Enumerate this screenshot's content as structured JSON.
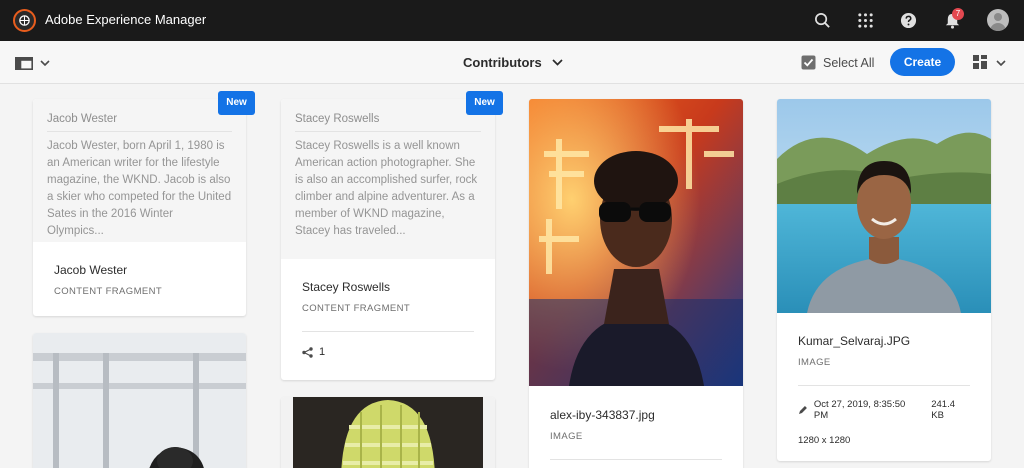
{
  "shell": {
    "title": "Adobe Experience Manager",
    "notification_count": "7",
    "icons": [
      "search-icon",
      "apps-grid-icon",
      "help-icon",
      "bell-icon",
      "user-avatar"
    ]
  },
  "actionbar": {
    "folder_title": "Contributors",
    "select_all_label": "Select All",
    "create_label": "Create"
  },
  "cards": [
    {
      "new_label": "New",
      "preview_title": "Jacob Wester",
      "preview_text": "Jacob Wester, born April 1, 1980 is an American writer for the lifestyle magazine, the WKND. Jacob is also a skier who competed for the United Sates in the 2016 Winter Olympics...",
      "name": "Jacob Wester",
      "type": "CONTENT FRAGMENT"
    },
    {
      "new_label": "New",
      "preview_title": "Stacey Roswells",
      "preview_text": "Stacey Roswells is a well known American action photographer. She is also an accomplished surfer, rock climber and alpine adventurer. As a member of WKND magazine, Stacey has traveled...",
      "name": "Stacey Roswells",
      "type": "CONTENT FRAGMENT",
      "references": "1"
    },
    {
      "name": "alex-iby-343837.jpg",
      "type": "IMAGE"
    },
    {
      "name": "Kumar_Selvaraj.JPG",
      "type": "IMAGE",
      "modified": "Oct 27, 2019, 8:35:50 PM",
      "size": "241.4 KB",
      "dimensions": "1280 x 1280"
    }
  ],
  "colors": {
    "accent": "#1473e6",
    "shell": "#1a1a1a",
    "brand": "#e85d1d"
  }
}
